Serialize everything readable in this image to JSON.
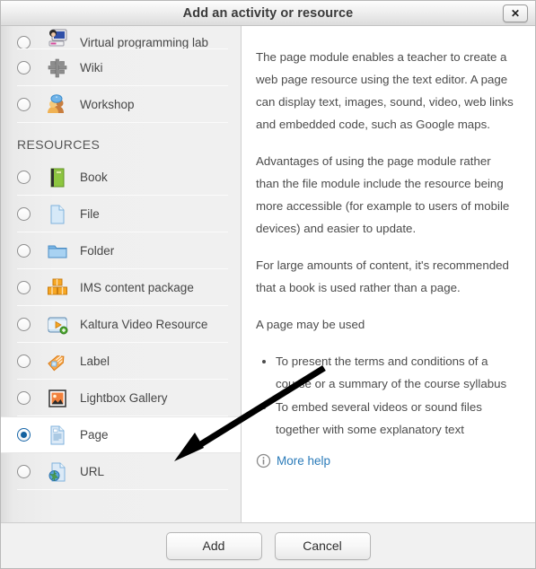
{
  "window": {
    "title": "Add an activity or resource",
    "close_label": "✕",
    "close_icon": "close-icon"
  },
  "list": {
    "items": [
      {
        "label": "Virtual programming lab",
        "icon": "vpl-icon",
        "selected": false,
        "clipped": true
      },
      {
        "label": "Wiki",
        "icon": "wiki-icon",
        "selected": false,
        "clipped": false
      },
      {
        "label": "Workshop",
        "icon": "workshop-icon",
        "selected": false,
        "clipped": false
      }
    ],
    "group_header": "RESOURCES",
    "resources": [
      {
        "label": "Book",
        "icon": "book-icon",
        "selected": false
      },
      {
        "label": "File",
        "icon": "file-icon",
        "selected": false
      },
      {
        "label": "Folder",
        "icon": "folder-icon",
        "selected": false
      },
      {
        "label": "IMS content package",
        "icon": "ims-package-icon",
        "selected": false
      },
      {
        "label": "Kaltura Video Resource",
        "icon": "kaltura-video-icon",
        "selected": false
      },
      {
        "label": "Label",
        "icon": "label-tag-icon",
        "selected": false
      },
      {
        "label": "Lightbox Gallery",
        "icon": "lightbox-gallery-icon",
        "selected": false
      },
      {
        "label": "Page",
        "icon": "page-icon",
        "selected": true
      },
      {
        "label": "URL",
        "icon": "url-icon",
        "selected": false
      }
    ]
  },
  "description": {
    "paragraphs": [
      "The page module enables a teacher to create a web page resource using the text editor. A page can display text, images, sound, video, web links and embedded code, such as Google maps.",
      "Advantages of using the page module rather than the file module include the resource being more accessible (for example to users of mobile devices) and easier to update.",
      "For large amounts of content, it's recommended that a book is used rather than a page.",
      "A page may be used"
    ],
    "bullets": [
      "To present the terms and conditions of a course or a summary of the course syllabus",
      "To embed several videos or sound files together with some explanatory text"
    ],
    "more_help": "More help",
    "more_help_icon": "info-circle-icon"
  },
  "footer": {
    "add_label": "Add",
    "cancel_label": "Cancel"
  },
  "colors": {
    "accent": "#15629f",
    "link": "#2b7bb9",
    "text": "#4c4c4c",
    "annotation_arrow": "#000000"
  }
}
